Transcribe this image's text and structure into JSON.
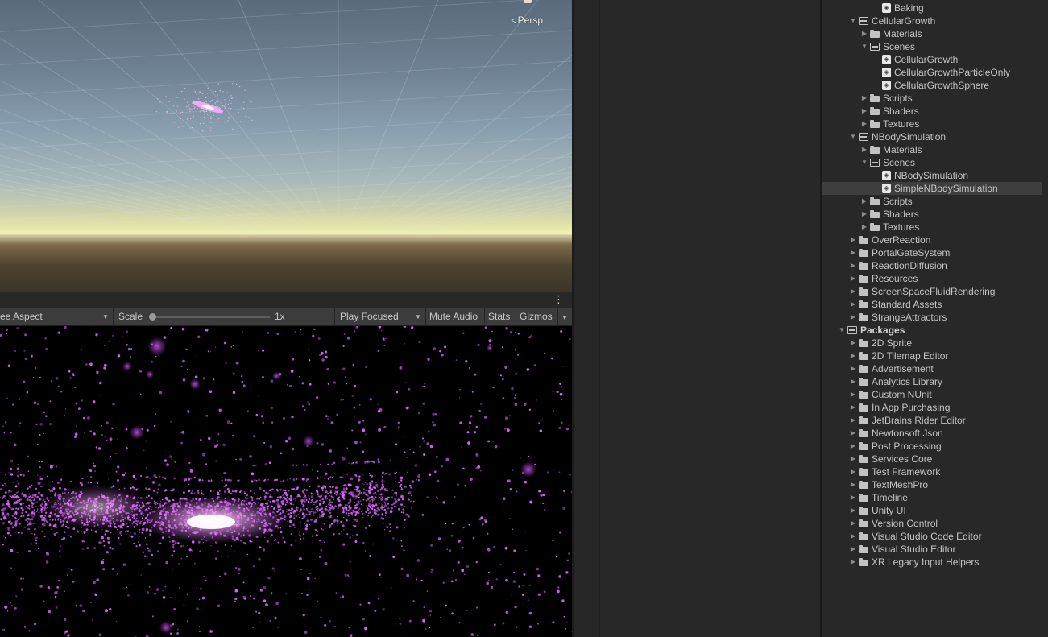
{
  "scene_view": {
    "camera_label": "Persp",
    "camera_icon": "perspective-icon"
  },
  "game_toolbar": {
    "aspect_label": "ee Aspect",
    "scale_label": "Scale",
    "scale_value": "1x",
    "scale_fraction": 0.0,
    "play_mode_label": "Play Focused",
    "mute_audio_label": "Mute Audio",
    "stats_label": "Stats",
    "gizmos_label": "Gizmos"
  },
  "colors": {
    "panel_bg": "#282828",
    "toolbar_bg": "#3c3c3c",
    "selection": "#3e3e3e",
    "particle": "#d966ff"
  },
  "project_tree": [
    {
      "label": "Baking",
      "type": "scene",
      "depth": 3
    },
    {
      "label": "CellularGrowth",
      "type": "folder",
      "depth": 1,
      "expanded": true
    },
    {
      "label": "Materials",
      "type": "folder",
      "depth": 2,
      "expanded": false
    },
    {
      "label": "Scenes",
      "type": "folder",
      "depth": 2,
      "expanded": true
    },
    {
      "label": "CellularGrowth",
      "type": "scene",
      "depth": 3
    },
    {
      "label": "CellularGrowthParticleOnly",
      "type": "scene",
      "depth": 3
    },
    {
      "label": "CellularGrowthSphere",
      "type": "scene",
      "depth": 3
    },
    {
      "label": "Scripts",
      "type": "folder",
      "depth": 2,
      "expanded": false
    },
    {
      "label": "Shaders",
      "type": "folder",
      "depth": 2,
      "expanded": false
    },
    {
      "label": "Textures",
      "type": "folder",
      "depth": 2,
      "expanded": false
    },
    {
      "label": "NBodySimulation",
      "type": "folder",
      "depth": 1,
      "expanded": true
    },
    {
      "label": "Materials",
      "type": "folder",
      "depth": 2,
      "expanded": false
    },
    {
      "label": "Scenes",
      "type": "folder",
      "depth": 2,
      "expanded": true
    },
    {
      "label": "NBodySimulation",
      "type": "scene",
      "depth": 3
    },
    {
      "label": "SimpleNBodySimulation",
      "type": "scene",
      "depth": 3,
      "selected": true
    },
    {
      "label": "Scripts",
      "type": "folder",
      "depth": 2,
      "expanded": false
    },
    {
      "label": "Shaders",
      "type": "folder",
      "depth": 2,
      "expanded": false
    },
    {
      "label": "Textures",
      "type": "folder",
      "depth": 2,
      "expanded": false
    },
    {
      "label": "OverReaction",
      "type": "folder",
      "depth": 1,
      "expanded": false
    },
    {
      "label": "PortalGateSystem",
      "type": "folder",
      "depth": 1,
      "expanded": false
    },
    {
      "label": "ReactionDiffusion",
      "type": "folder",
      "depth": 1,
      "expanded": false
    },
    {
      "label": "Resources",
      "type": "folder",
      "depth": 1,
      "expanded": false
    },
    {
      "label": "ScreenSpaceFluidRendering",
      "type": "folder",
      "depth": 1,
      "expanded": false
    },
    {
      "label": "Standard Assets",
      "type": "folder",
      "depth": 1,
      "expanded": false
    },
    {
      "label": "StrangeAttractors",
      "type": "folder",
      "depth": 1,
      "expanded": false
    },
    {
      "label": "Packages",
      "type": "folder",
      "depth": 0,
      "expanded": true,
      "bold": true
    },
    {
      "label": "2D Sprite",
      "type": "folder",
      "depth": 1,
      "expanded": false
    },
    {
      "label": "2D Tilemap Editor",
      "type": "folder",
      "depth": 1,
      "expanded": false
    },
    {
      "label": "Advertisement",
      "type": "folder",
      "depth": 1,
      "expanded": false
    },
    {
      "label": "Analytics Library",
      "type": "folder",
      "depth": 1,
      "expanded": false
    },
    {
      "label": "Custom NUnit",
      "type": "folder",
      "depth": 1,
      "expanded": false
    },
    {
      "label": "In App Purchasing",
      "type": "folder",
      "depth": 1,
      "expanded": false
    },
    {
      "label": "JetBrains Rider Editor",
      "type": "folder",
      "depth": 1,
      "expanded": false
    },
    {
      "label": "Newtonsoft Json",
      "type": "folder",
      "depth": 1,
      "expanded": false
    },
    {
      "label": "Post Processing",
      "type": "folder",
      "depth": 1,
      "expanded": false
    },
    {
      "label": "Services Core",
      "type": "folder",
      "depth": 1,
      "expanded": false
    },
    {
      "label": "Test Framework",
      "type": "folder",
      "depth": 1,
      "expanded": false
    },
    {
      "label": "TextMeshPro",
      "type": "folder",
      "depth": 1,
      "expanded": false
    },
    {
      "label": "Timeline",
      "type": "folder",
      "depth": 1,
      "expanded": false
    },
    {
      "label": "Unity UI",
      "type": "folder",
      "depth": 1,
      "expanded": false
    },
    {
      "label": "Version Control",
      "type": "folder",
      "depth": 1,
      "expanded": false
    },
    {
      "label": "Visual Studio Code Editor",
      "type": "folder",
      "depth": 1,
      "expanded": false
    },
    {
      "label": "Visual Studio Editor",
      "type": "folder",
      "depth": 1,
      "expanded": false
    },
    {
      "label": "XR Legacy Input Helpers",
      "type": "folder",
      "depth": 1,
      "expanded": false
    }
  ]
}
